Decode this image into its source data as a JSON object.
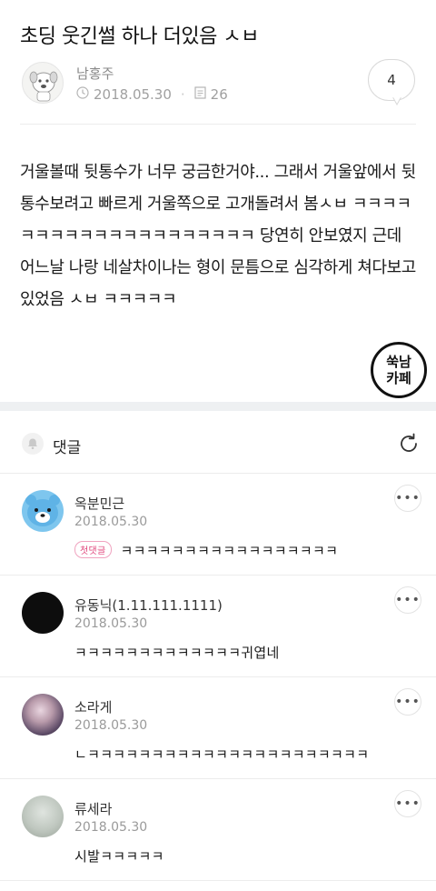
{
  "post": {
    "title": "초딩 웃긴썰 하나 더있음 ㅅㅂ",
    "author": "남홍주",
    "date": "2018.05.30",
    "views": "26",
    "comment_count": "4",
    "body": "거울볼때 뒷통수가 너무 궁금한거야... 그래서 거울앞에서 뒷통수보려고 빠르게 거울쪽으로 고개돌려서 봄ㅅㅂ ㅋㅋㅋㅋㅋㅋㅋㅋㅋㅋㅋㅋㅋㅋㅋㅋㅋㅋㅋㅋ 당연히 안보였지 근데 어느날 나랑 네살차이나는 형이 문틈으로 심각하게 쳐다보고 있었음 ㅅㅂ ㅋㅋㅋㅋㅋ",
    "cafe_logo_line1": "쑥남",
    "cafe_logo_line2": "카페"
  },
  "comments_section": {
    "label": "댓글"
  },
  "comments": [
    {
      "name": "옥분민근",
      "date": "2018.05.30",
      "badge": "첫댓글",
      "text": "ㅋㅋㅋㅋㅋㅋㅋㅋㅋㅋㅋㅋㅋㅋㅋㅋㅋ",
      "avatar_color": "#7ec6ee"
    },
    {
      "name": "유동닉(1.11.111.1111)",
      "date": "2018.05.30",
      "text": "ㅋㅋㅋㅋㅋㅋㅋㅋㅋㅋㅋㅋㅋ귀엽네",
      "avatar_color": "#0d0d0d"
    },
    {
      "name": "소라게",
      "date": "2018.05.30",
      "text": "ㄴㅋㅋㅋㅋㅋㅋㅋㅋㅋㅋㅋㅋㅋㅋㅋㅋㅋㅋㅋㅋㅋㅋ",
      "avatar_color": "#6d5a78"
    },
    {
      "name": "류세라",
      "date": "2018.05.30",
      "text": "시발ㅋㅋㅋㅋㅋ",
      "avatar_color": "#bfc7bf"
    }
  ],
  "icons": {
    "clock": "clock-icon",
    "views": "document-icon",
    "bell": "bell-icon",
    "refresh": "refresh-icon",
    "more": "more-icon"
  }
}
